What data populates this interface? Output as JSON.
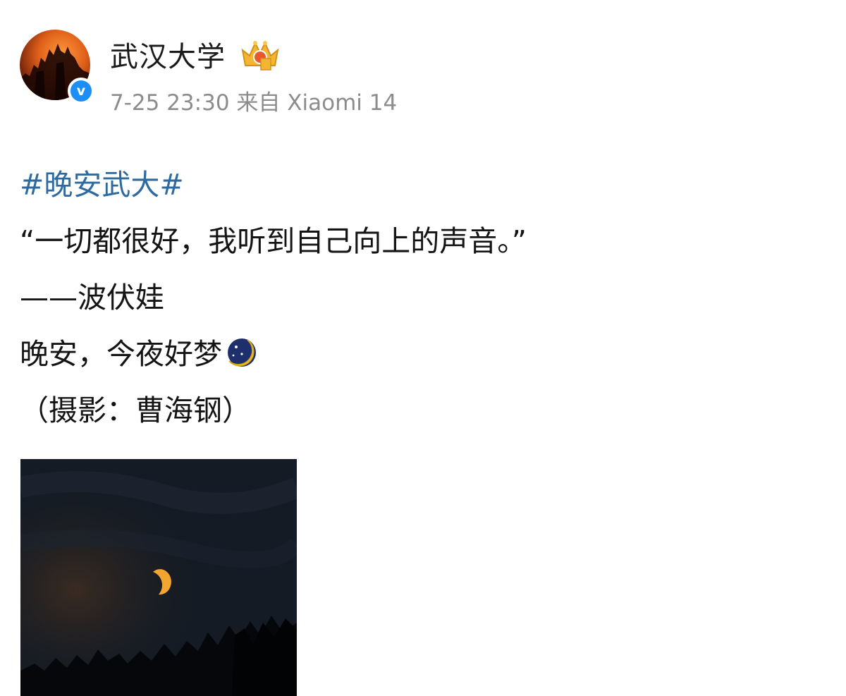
{
  "author": {
    "name": "武汉大学",
    "avatar_icon": "university-gate-avatar",
    "verified_icon": "verified-blue-v-icon",
    "verified_mark": "v",
    "badge_icon": "crown-level-badge-icon"
  },
  "meta": {
    "time": "7-25 23:30",
    "source": "来自 Xiaomi 14"
  },
  "post": {
    "hashtag": "#晚安武大#",
    "quote": "“一切都很好，我听到自己向上的声音。”",
    "attribution": "——波伏娃",
    "goodnight": "晚安，今夜好梦",
    "goodnight_emoji": "moon-and-stars-icon",
    "credit": "（摄影：曹海钢）"
  },
  "photo": {
    "description_icon": "night-sky-moon-photo"
  },
  "colors": {
    "hashtag": "#2c6aa0",
    "meta": "#8c8c8c",
    "verified": "#1d8ef5"
  }
}
